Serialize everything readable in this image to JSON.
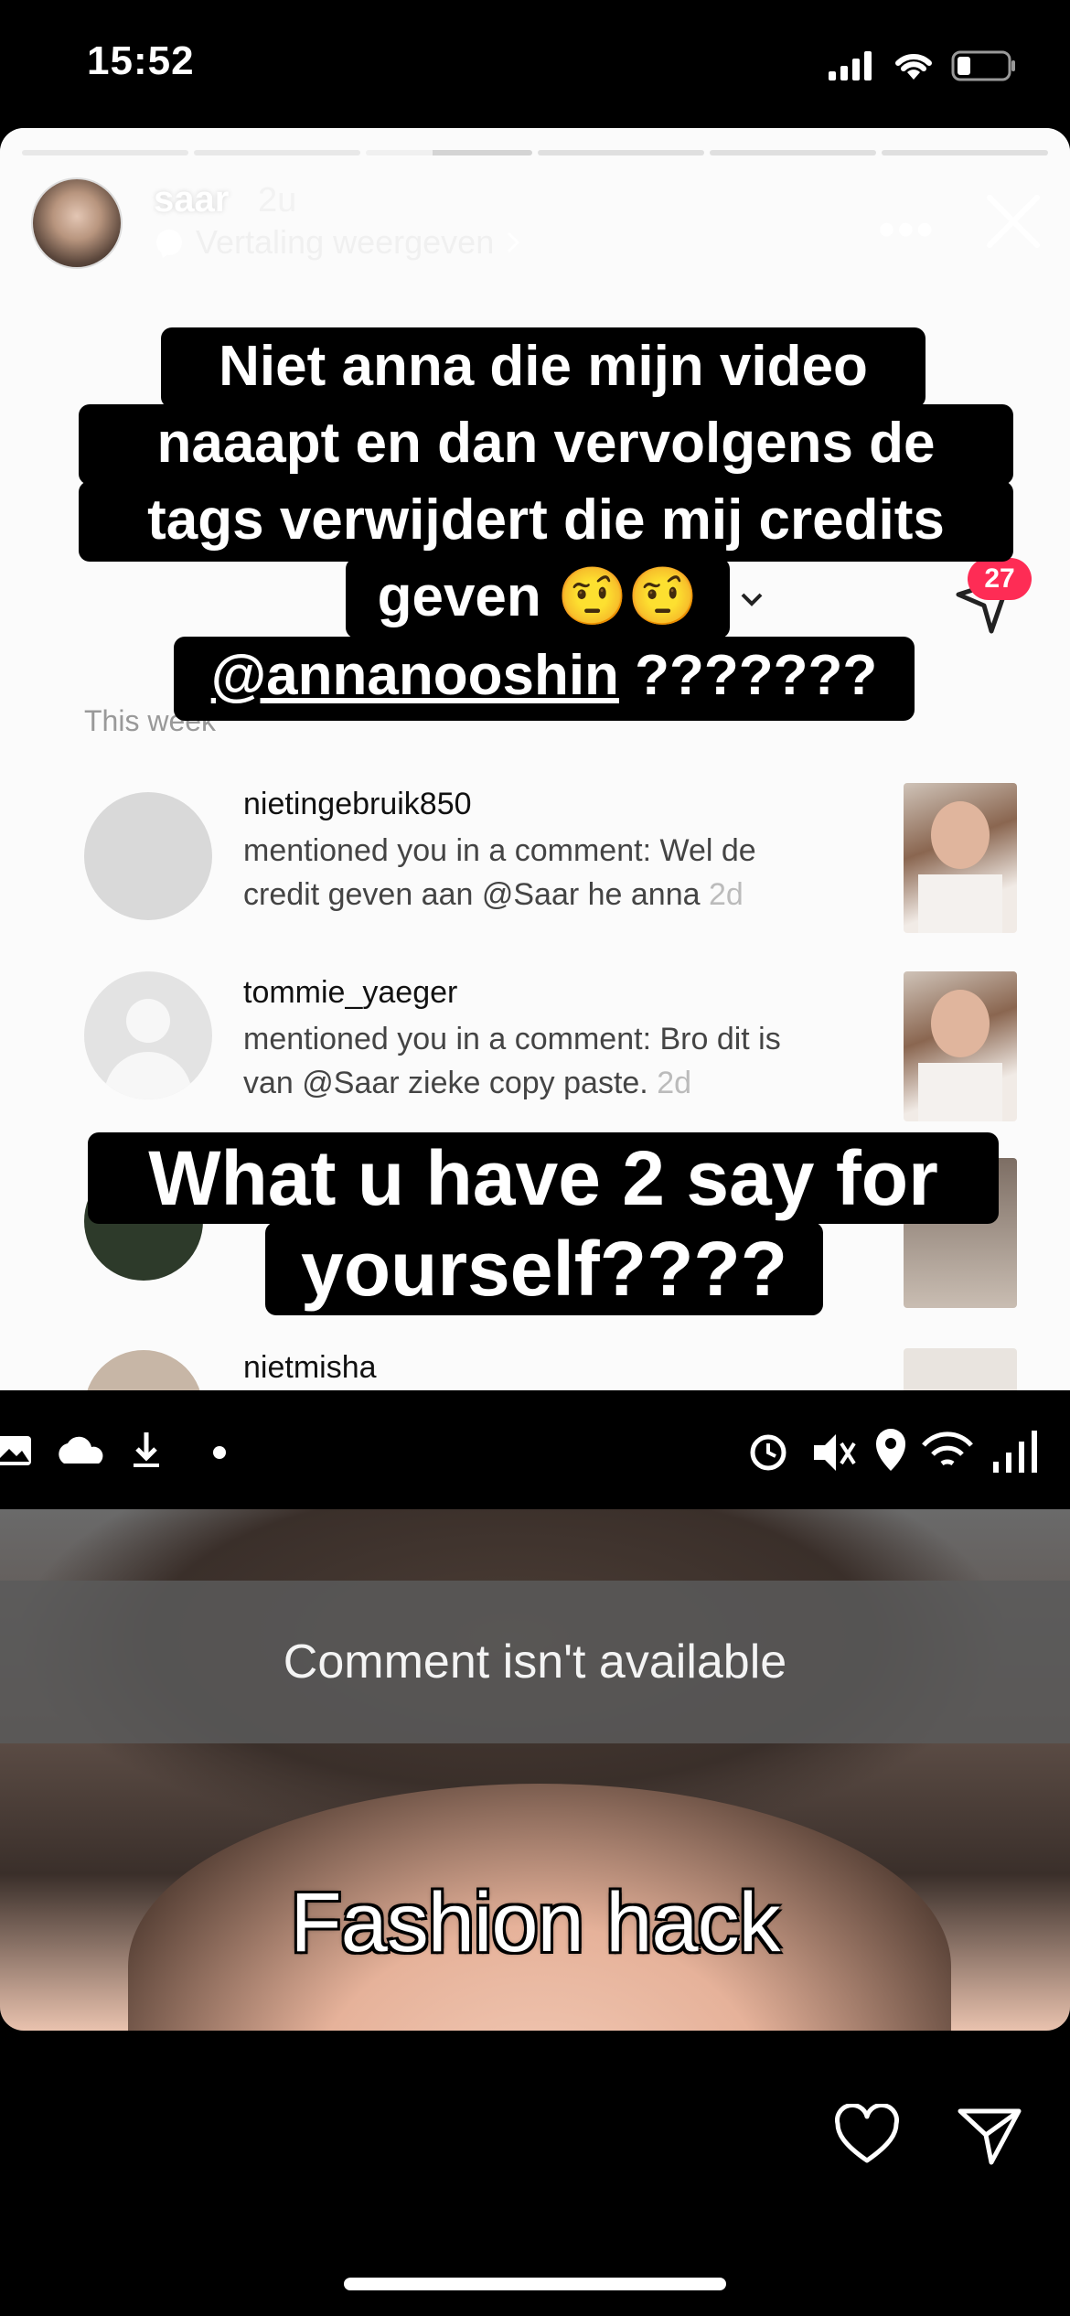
{
  "status_bar": {
    "time": "15:52",
    "icons": [
      "signal-icon",
      "wifi-icon",
      "battery-icon"
    ]
  },
  "story": {
    "progress": {
      "segments": 6,
      "current": 3
    },
    "username": "saar",
    "time_ago": "2u",
    "translate_label": "Vertaling weergeven",
    "more_label": "•••"
  },
  "overlay": {
    "lines1": [
      "Niet anna die mijn video",
      "naaapt en dan vervolgens de",
      "tags verwijdert die mij credits",
      "geven 🤨🤨"
    ],
    "mention": "@annanooshin",
    "mention_suffix": " ???????",
    "lines2": [
      "What u have 2 say for",
      "yourself????"
    ]
  },
  "screenshot": {
    "section_label": "This week",
    "notification_badge": "27",
    "items": [
      {
        "name": "nietingebruik850",
        "line1": "mentioned you in a comment: Wel de",
        "line2": "credit geven aan @Saar he anna",
        "ago": "2d"
      },
      {
        "name": "tommie_yaeger",
        "line1": "mentioned you in a comment: Bro dit is",
        "line2": "van @Saar zieke copy paste.",
        "ago": "2d"
      },
      {
        "name": "nietmisha"
      }
    ],
    "thumb_label": "Fashion hack"
  },
  "video": {
    "comment_unavailable": "Comment isn't available",
    "caption": "Fashion hack"
  },
  "colors": {
    "badge": "#fe2c55",
    "overlay_bg": "#000000",
    "link": "#ffffff"
  }
}
